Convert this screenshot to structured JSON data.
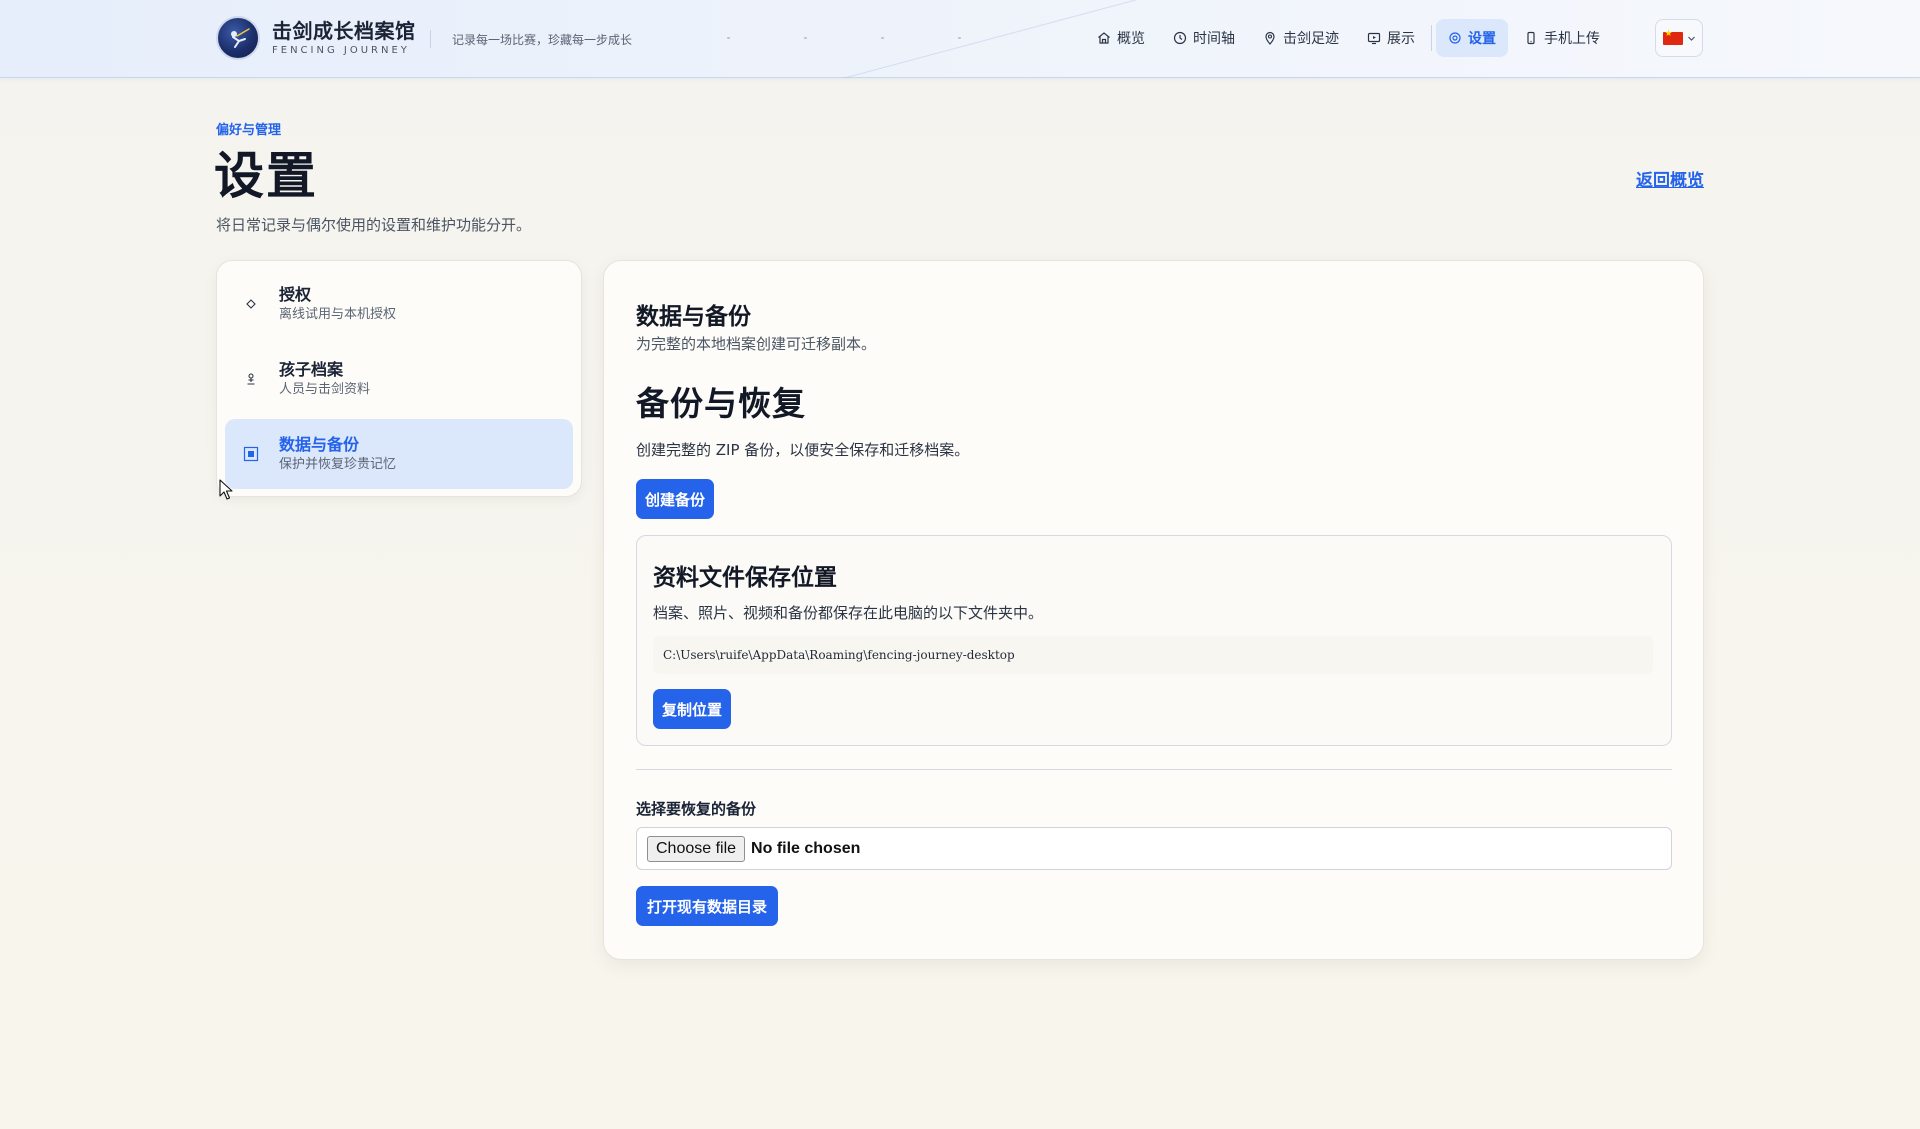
{
  "app": {
    "title": "击剑成长档案馆",
    "subtitle": "FENCING JOURNEY",
    "tagline": "记录每一场比赛，珍藏每一步成长"
  },
  "nav": {
    "items": [
      {
        "label": "概览",
        "icon": "home-icon",
        "active": false
      },
      {
        "label": "时间轴",
        "icon": "clock-icon",
        "active": false
      },
      {
        "label": "击剑足迹",
        "icon": "map-pin-icon",
        "active": false
      },
      {
        "label": "展示",
        "icon": "presentation-icon",
        "active": false
      },
      {
        "label": "设置",
        "icon": "gear-icon",
        "active": true
      },
      {
        "label": "手机上传",
        "icon": "phone-icon",
        "active": false
      }
    ],
    "language": {
      "flag": "cn-flag-icon"
    }
  },
  "page": {
    "eyebrow": "偏好与管理",
    "title": "设置",
    "description": "将日常记录与偶尔使用的设置和维护功能分开。",
    "back_link": "返回概览"
  },
  "sidebar": {
    "items": [
      {
        "label": "授权",
        "sub": "离线试用与本机授权",
        "icon": "diamond-icon",
        "active": false
      },
      {
        "label": "孩子档案",
        "sub": "人员与击剑资料",
        "icon": "person-icon",
        "active": false
      },
      {
        "label": "数据与备份",
        "sub": "保护并恢复珍贵记忆",
        "icon": "database-icon",
        "active": true
      }
    ]
  },
  "panel": {
    "title": "数据与备份",
    "subtitle": "为完整的本地档案创建可迁移副本。",
    "section_title": "备份与恢复",
    "section_text": "创建完整的 ZIP 备份，以便安全保存和迁移档案。",
    "create_backup": "创建备份",
    "storage": {
      "title": "资料文件保存位置",
      "text": "档案、照片、视频和备份都保存在此电脑的以下文件夹中。",
      "path": "C:\\Users\\ruife\\AppData\\Roaming\\fencing-journey-desktop",
      "copy_button": "复制位置"
    },
    "restore_label": "选择要恢复的备份",
    "file_button": "Choose file",
    "file_status": "No file chosen",
    "open_dir_button": "打开现有数据目录"
  },
  "colors": {
    "accent": "#2563eb",
    "active_bg": "#dbe7fb"
  }
}
